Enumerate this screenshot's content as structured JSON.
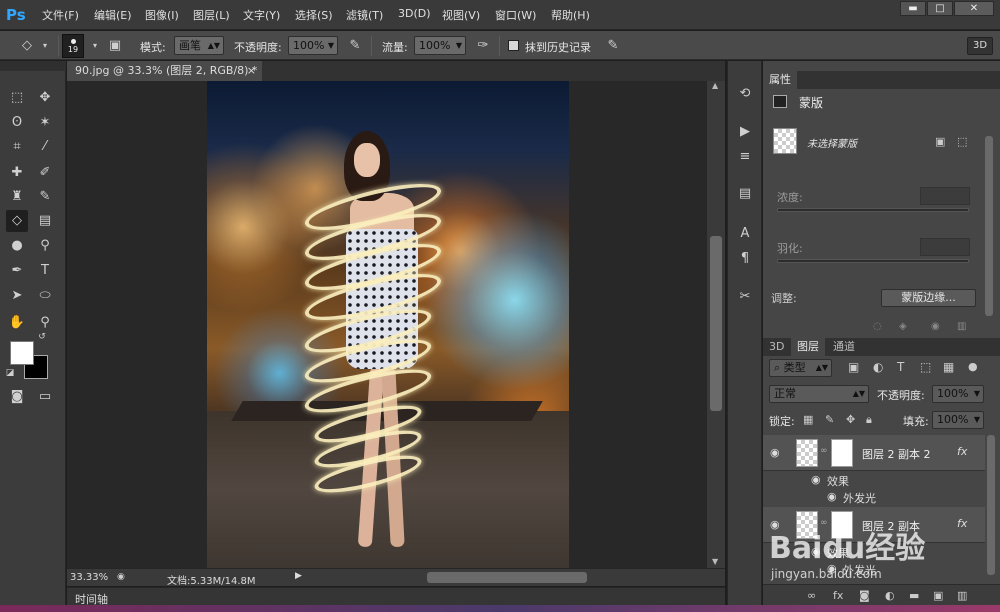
{
  "app": {
    "logo": "Ps"
  },
  "menu": [
    "文件(F)",
    "编辑(E)",
    "图像(I)",
    "图层(L)",
    "文字(Y)",
    "选择(S)",
    "滤镜(T)",
    "3D(D)",
    "视图(V)",
    "窗口(W)",
    "帮助(H)"
  ],
  "window_controls": {
    "minimize": "▬",
    "maximize": "□",
    "close": "✕"
  },
  "options": {
    "brush_size": "19",
    "mode_label": "模式:",
    "mode_value": "画笔",
    "opacity_label": "不透明度:",
    "opacity_value": "100%",
    "flow_label": "流量:",
    "flow_value": "100%",
    "history_label": "抹到历史记录",
    "btn_3d": "3D"
  },
  "document": {
    "tab_title": "90.jpg @ 33.3% (图层 2, RGB/8) *",
    "tab_close": "×",
    "zoom": "33.33%",
    "doc_info": "文档:5.33M/14.8M"
  },
  "timeline": {
    "label": "时间轴"
  },
  "properties": {
    "tab": "属性",
    "mask_title": "蒙版",
    "mask_status": "未选择蒙版",
    "density_label": "浓度:",
    "feather_label": "羽化:",
    "adjust_label": "调整:",
    "refine_button": "蒙版边缘..."
  },
  "layers_panel": {
    "tabs": [
      "3D",
      "图层",
      "通道"
    ],
    "filter_label": "类型",
    "blend_mode": "正常",
    "opacity_label": "不透明度:",
    "opacity_value": "100%",
    "lock_label": "锁定:",
    "fill_label": "填充:",
    "fill_value": "100%",
    "layers": [
      {
        "name": "图层 2 副本 2",
        "fx": "fx",
        "effects_label": "效果",
        "effect": "外发光"
      },
      {
        "name": "图层 2 副本",
        "fx": "fx",
        "effects_label": "效果",
        "effect": "外发光"
      }
    ]
  },
  "watermark": {
    "brand": "Baidu经验",
    "url": "jingyan.baidu.com"
  },
  "icons": {
    "toolbox": [
      "marquee-icon",
      "move-icon",
      "lasso-icon",
      "magic-wand-icon",
      "crop-icon",
      "eyedropper-icon",
      "healing-brush-icon",
      "brush-icon",
      "clone-stamp-icon",
      "history-brush-icon",
      "eraser-icon",
      "gradient-icon",
      "blur-icon",
      "dodge-icon",
      "pen-icon",
      "type-icon",
      "path-selection-icon",
      "ellipse-icon",
      "hand-icon",
      "zoom-icon"
    ],
    "side_column": [
      "history-icon",
      "actions-icon",
      "adjustments-icon",
      "layer-comps-icon",
      "character-icon",
      "paragraph-icon",
      "tool-presets-icon"
    ]
  },
  "colors": {
    "accent": "#31a8ff",
    "foreground": "#ffffff",
    "background": "#000000",
    "glow": "#faeebe"
  }
}
